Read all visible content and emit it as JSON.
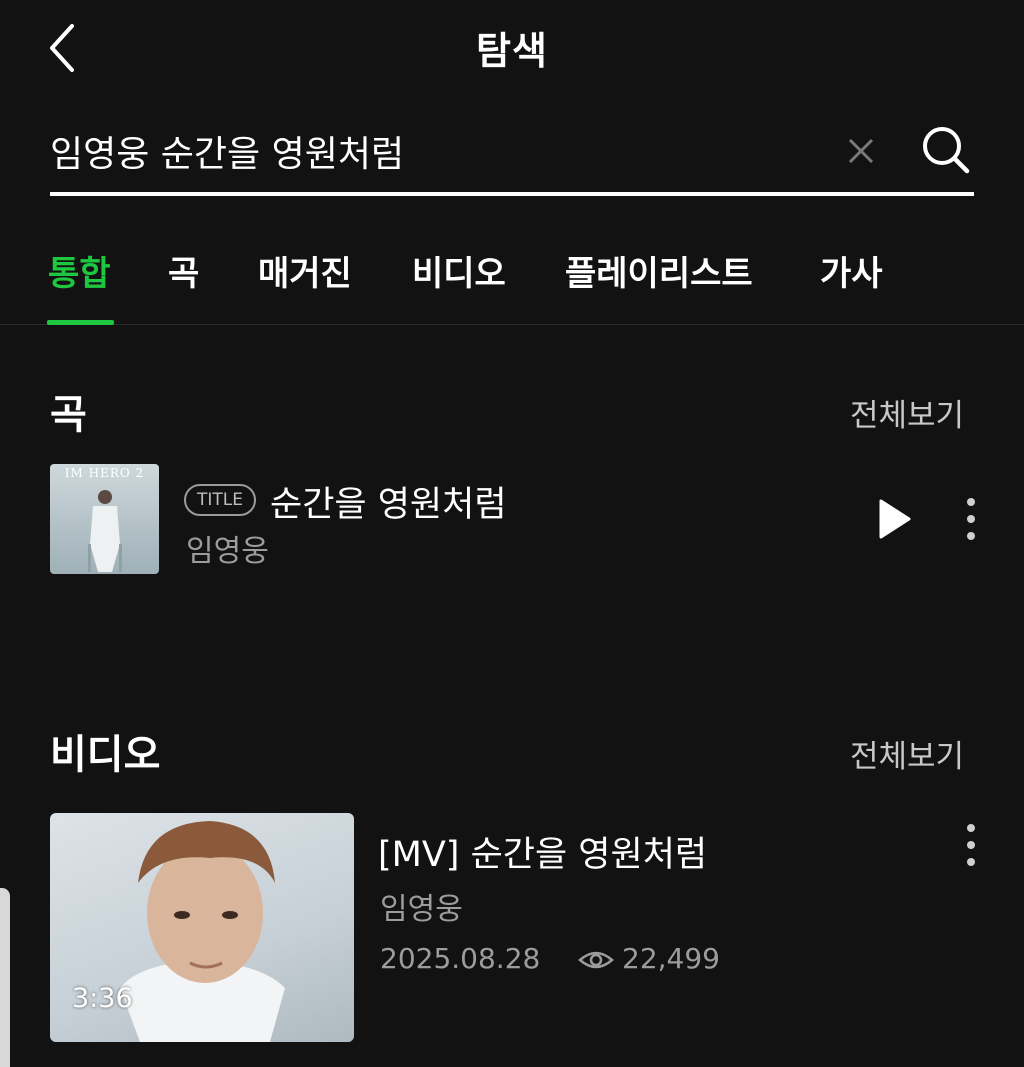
{
  "header": {
    "title": "탐색",
    "back_icon": "chevron-left-icon"
  },
  "search": {
    "value": "임영웅 순간을 영원처럼",
    "clear_icon": "close-icon",
    "search_icon": "search-icon"
  },
  "tabs": [
    {
      "label": "통합",
      "active": true
    },
    {
      "label": "곡",
      "active": false
    },
    {
      "label": "매거진",
      "active": false
    },
    {
      "label": "비디오",
      "active": false
    },
    {
      "label": "플레이리스트",
      "active": false
    },
    {
      "label": "가사",
      "active": false
    }
  ],
  "songs_section": {
    "title": "곡",
    "see_all": "전체보기",
    "items": [
      {
        "album_text": "IM HERO 2",
        "badge": "TITLE",
        "title": "순간을 영원처럼",
        "artist": "임영웅"
      }
    ]
  },
  "videos_section": {
    "title": "비디오",
    "see_all": "전체보기",
    "items": [
      {
        "title": "[MV] 순간을 영원처럼",
        "artist": "임영웅",
        "date": "2025.08.28",
        "views": "22,499",
        "duration": "3:36"
      }
    ]
  },
  "colors": {
    "accent": "#1dc840",
    "background": "#121212",
    "muted_text": "#9c9c9c"
  }
}
